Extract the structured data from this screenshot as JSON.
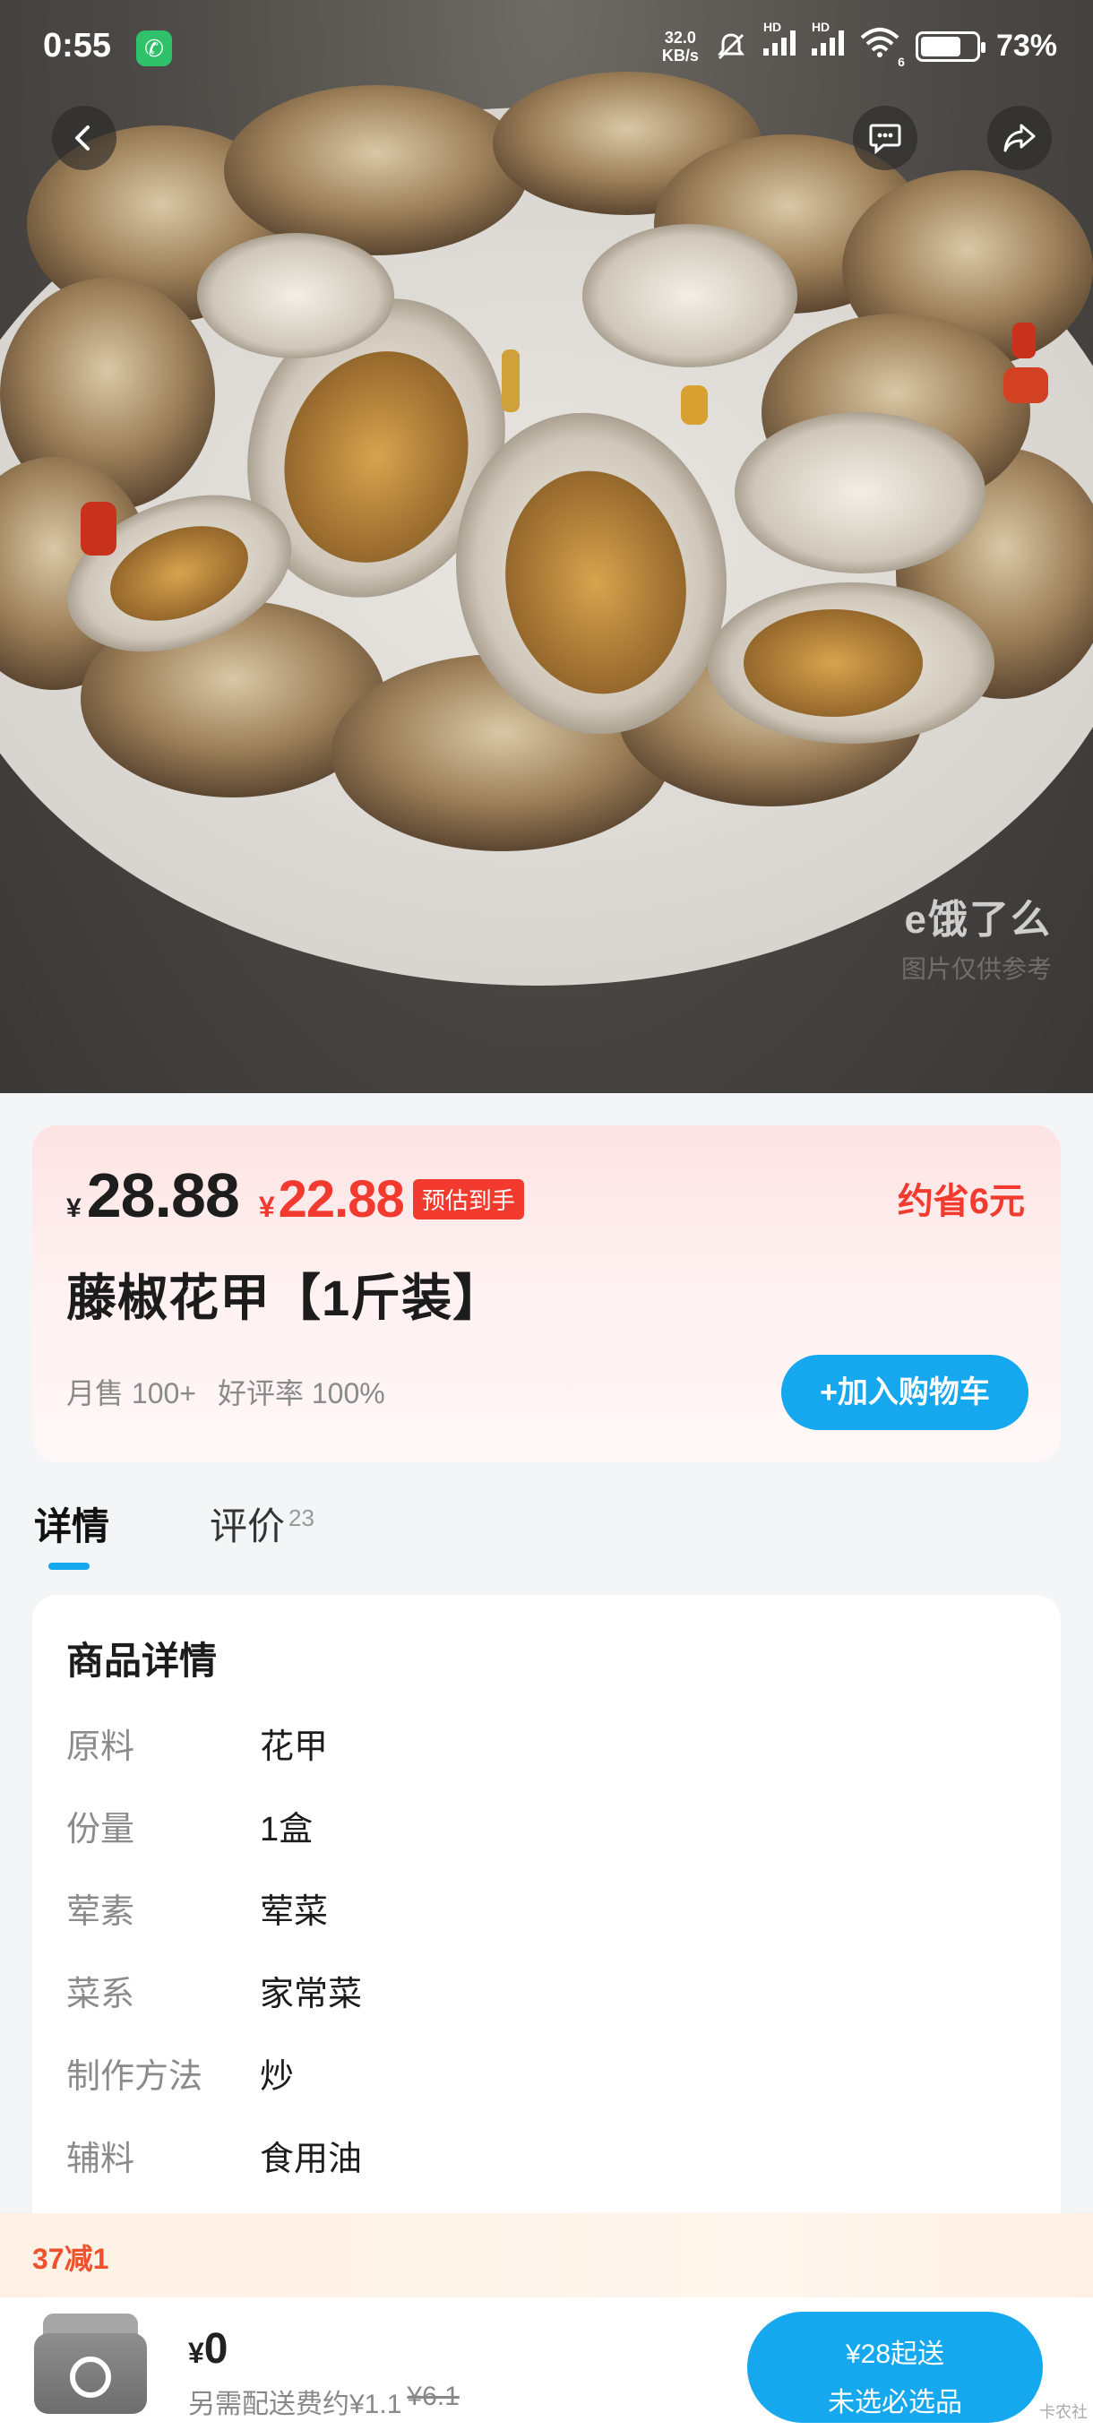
{
  "status_bar": {
    "time": "0:55",
    "net_speed_value": "32.0",
    "net_speed_unit": "KB/s",
    "battery": "73%",
    "battery_level": 0.73,
    "signal_label_1": "HD",
    "signal_label_2": "HD",
    "wifi_sub": "6"
  },
  "hero": {
    "watermark_logo": "e饿了么",
    "watermark_note": "图片仅供参考"
  },
  "product": {
    "price_yen": "¥",
    "price_original": "28.88",
    "price_now_yen": "¥",
    "price_now": "22.88",
    "estimate_tag": "预估到手",
    "save_text": "约省6元",
    "title": "藤椒花甲【1斤装】",
    "monthly_sales": "月售 100+",
    "rating": "好评率 100%",
    "add_to_cart": "+加入购物车"
  },
  "tabs": [
    {
      "label": "详情",
      "count": ""
    },
    {
      "label": "评价",
      "count": "23"
    }
  ],
  "details": {
    "title": "商品详情",
    "rows": [
      {
        "key": "原料",
        "value": "花甲"
      },
      {
        "key": "份量",
        "value": "1盒"
      },
      {
        "key": "荤素",
        "value": "荤菜"
      },
      {
        "key": "菜系",
        "value": "家常菜"
      },
      {
        "key": "制作方法",
        "value": "炒"
      },
      {
        "key": "辅料",
        "value": "食用油"
      }
    ]
  },
  "promo": {
    "text": "37减1"
  },
  "cart_bar": {
    "amount_yen": "¥",
    "amount": "0",
    "delivery_prefix": "另需配送费约¥1.1",
    "delivery_original": "¥6.1",
    "checkout_line1": "¥28起送",
    "checkout_line2": "未选必选品",
    "corner_mark": "卡农社"
  },
  "colors": {
    "accent": "#16a8ee",
    "price_red": "#f23b2e",
    "promo_orange": "#f0512d"
  }
}
